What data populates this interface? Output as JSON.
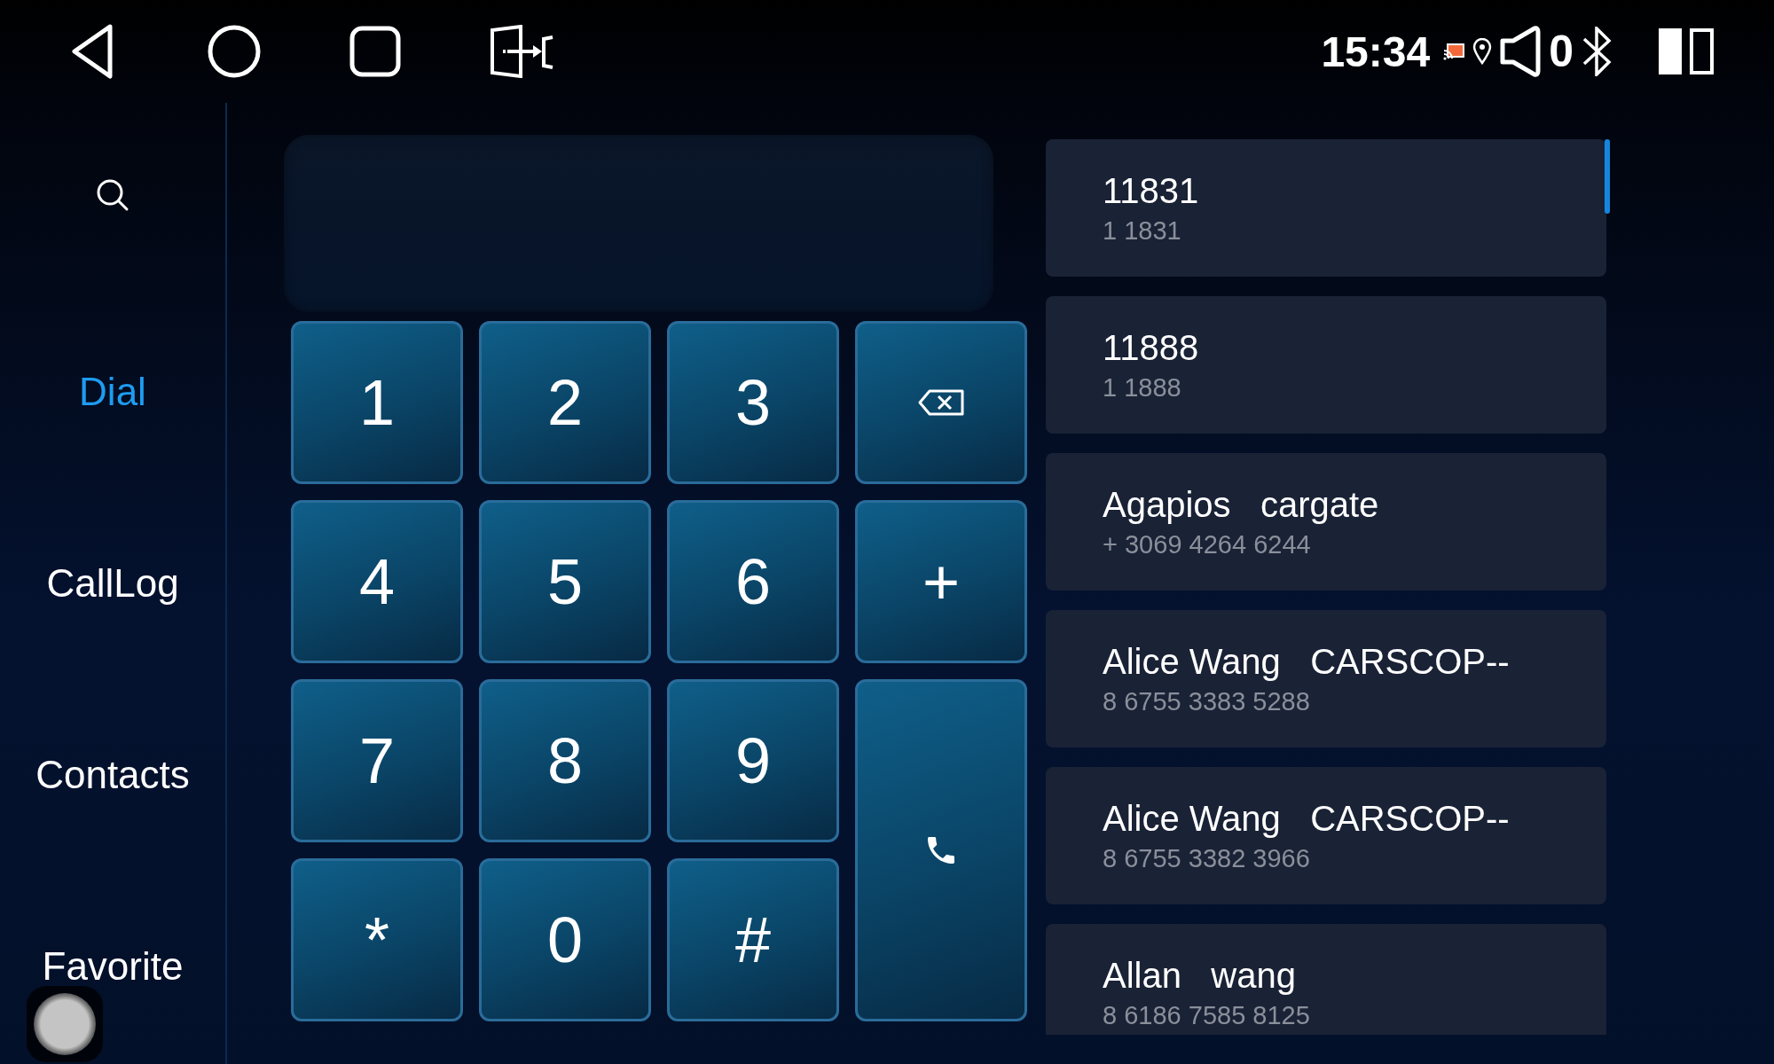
{
  "status_bar": {
    "time": "15:34",
    "volume": "0"
  },
  "sidebar": {
    "items": [
      {
        "label": "Dial",
        "selected": true
      },
      {
        "label": "CallLog",
        "selected": false
      },
      {
        "label": "Contacts",
        "selected": false
      },
      {
        "label": "Favorite",
        "selected": false
      }
    ]
  },
  "keypad": {
    "keys": [
      {
        "kind": "digit",
        "label": "1"
      },
      {
        "kind": "digit",
        "label": "2"
      },
      {
        "kind": "digit",
        "label": "3"
      },
      {
        "kind": "backspace"
      },
      {
        "kind": "digit",
        "label": "4"
      },
      {
        "kind": "digit",
        "label": "5"
      },
      {
        "kind": "digit",
        "label": "6"
      },
      {
        "kind": "digit",
        "label": "+"
      },
      {
        "kind": "digit",
        "label": "7"
      },
      {
        "kind": "digit",
        "label": "8"
      },
      {
        "kind": "digit",
        "label": "9"
      },
      {
        "kind": "call"
      },
      {
        "kind": "digit",
        "label": "*"
      },
      {
        "kind": "digit",
        "label": "0"
      },
      {
        "kind": "digit",
        "label": "#"
      }
    ]
  },
  "contacts": [
    {
      "name": "11831",
      "number": "1 1831"
    },
    {
      "name": "11888",
      "number": "1 1888"
    },
    {
      "name": "Agapios   cargate",
      "number": "+ 3069 4264 6244"
    },
    {
      "name": "Alice Wang   CARSCOP--",
      "number": "8 6755 3383 5288"
    },
    {
      "name": "Alice Wang   CARSCOP--",
      "number": "8 6755 3382 3966"
    },
    {
      "name": "Allan   wang",
      "number": "8 6186 7585 8125"
    }
  ]
}
